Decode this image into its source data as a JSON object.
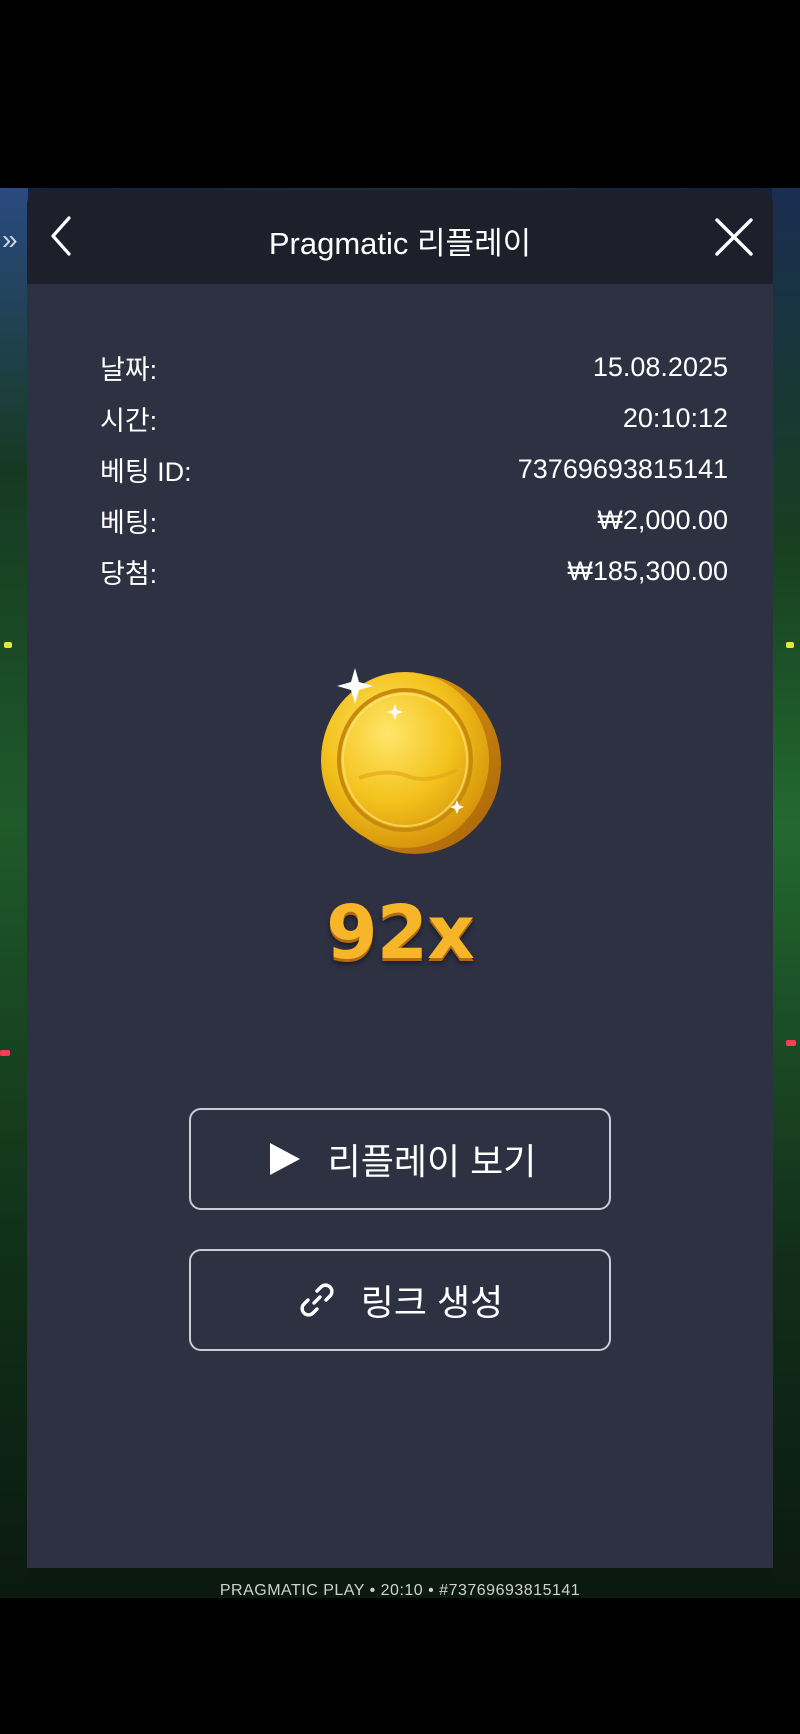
{
  "modal": {
    "title": "Pragmatic 리플레이"
  },
  "details": [
    {
      "label": "날짜:",
      "value": "15.08.2025"
    },
    {
      "label": "시간:",
      "value": "20:10:12"
    },
    {
      "label": "베팅 ID:",
      "value": "73769693815141"
    },
    {
      "label": "베팅:",
      "value": "₩2,000.00"
    },
    {
      "label": "당첨:",
      "value": "₩185,300.00"
    }
  ],
  "multiplier": "92x",
  "buttons": {
    "replay_label": "리플레이 보기",
    "link_label": "링크 생성"
  },
  "footer": {
    "info": "PRAGMATIC PLAY • 20:10 • #73769693815141"
  },
  "colors": {
    "modal_bg": "#2d3142",
    "header_bg": "#1d202b",
    "multiplier": "#f7b52a",
    "coin": "#f3c21c"
  },
  "icons": [
    "back-icon",
    "close-icon",
    "play-icon",
    "link-icon",
    "coin-icon",
    "chevrons-icon"
  ]
}
